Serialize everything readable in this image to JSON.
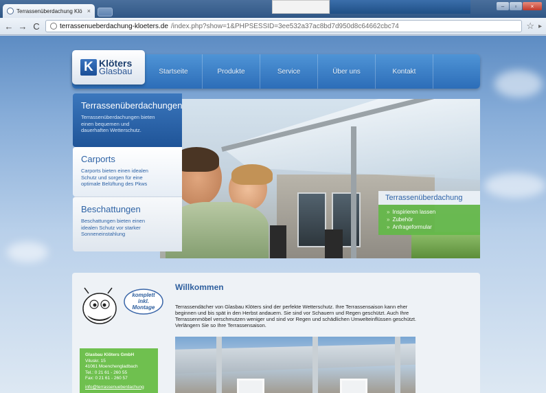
{
  "browser": {
    "tab_title": "Terrassenüberdachung Klö",
    "tab_close": "×",
    "url_domain": "terrassenueberdachung-kloeters.de",
    "url_path": "/index.php?show=1&PHPSESSID=3ee532a37ac8bd7d950d8c64662cbc74",
    "back_icon": "←",
    "forward_icon": "→",
    "reload_icon": "C",
    "bookmark_icon": "☆"
  },
  "site": {
    "logo_line1": "Klöters",
    "logo_line2": "Glasbau",
    "logo_mark": "K",
    "nav": [
      "Startseite",
      "Produkte",
      "Service",
      "Über uns",
      "Kontakt"
    ],
    "products": [
      {
        "title": "Terrassenüberdachungen",
        "text": "Terrassenüberdachungen bieten einen bequemen und dauerhaften Wetterschutz."
      },
      {
        "title": "Carports",
        "text": "Carports bieten einen idealen Schutz und sorgen für eine optimale Belüftung des Pkws"
      },
      {
        "title": "Beschattungen",
        "text": "Beschattungen bieten einen idealen Schutz vor starker Sonneneinstahlung"
      }
    ],
    "hero_callout": {
      "title": "Terrassenüberdachung",
      "links": [
        "Inspirieren lassen",
        "Zubehör",
        "Anfrageformular"
      ],
      "bullet": "»"
    },
    "welcome": {
      "title": "Willkommen",
      "text": "Terrassendächer von Glasbau Klöters sind der perfekte Wetterschutz. Ihre Terrassensaison kann eher beginnen und bis spät in den Herbst andauern. Sie sind vor Schauern und Regen geschützt. Auch Ihre Terrassenmöbel verschmutzen weniger und sind vor Regen und schädlichen Umwelteinflüssen geschützt. Verlängern Sie so Ihre Terrassensaison."
    },
    "mascot_text": [
      "komplett",
      "inkl.",
      "Montage"
    ],
    "company": {
      "name": "Glasbau Klöters GmbH",
      "street": "Viluskr. 15",
      "city": "41061 Moenchengladbach",
      "phone": "Tel.: 0 21 61 - 260 55",
      "fax": "Fax: 0 21 61 - 260 57",
      "email": "info@terrassenueberdachung"
    }
  },
  "colors": {
    "nav_blue": "#2c6db8",
    "callout_green": "#63b848",
    "heading_blue": "#2e5f9e"
  }
}
